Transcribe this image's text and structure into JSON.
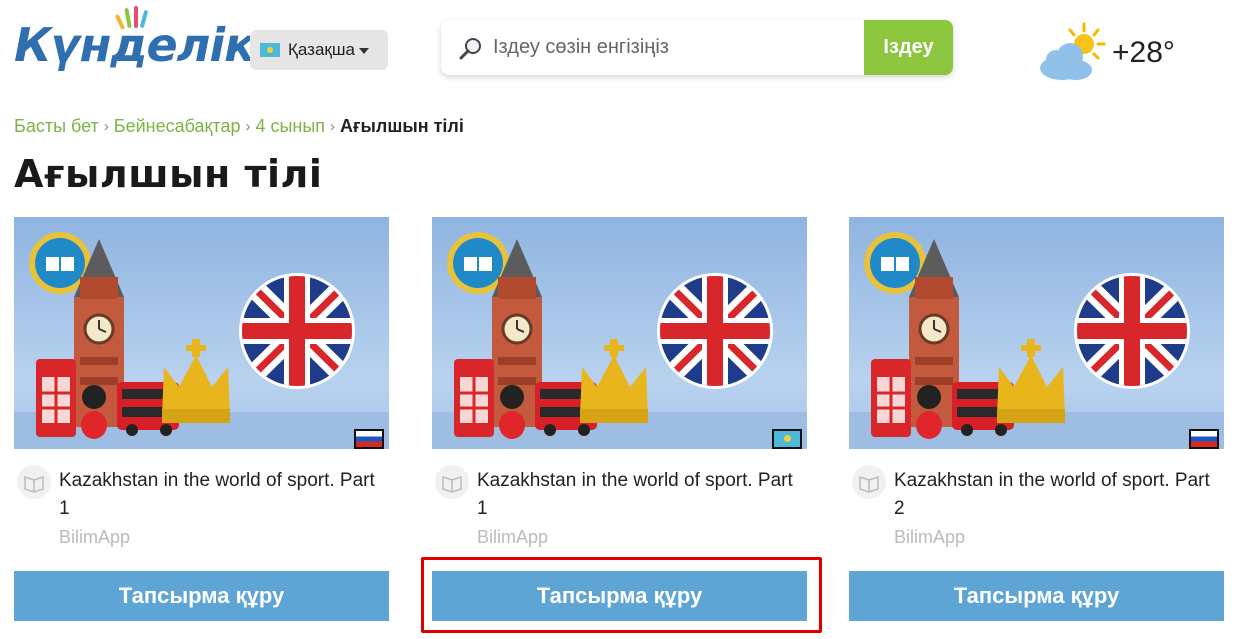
{
  "header": {
    "logo_text": "Күнделік",
    "language": {
      "label": "Қазақша",
      "flag_icon": "kazakhstan-flag-icon"
    },
    "search": {
      "placeholder": "Іздеу сөзін енгізіңіз",
      "value": "",
      "button_label": "Іздеу",
      "icon": "magnifier-icon"
    },
    "weather": {
      "icon": "sun-cloud-icon",
      "temperature": "+28°"
    }
  },
  "breadcrumb": [
    {
      "label": "Басты бет"
    },
    {
      "label": "Бейнесабақтар"
    },
    {
      "label": "4 сынып"
    },
    {
      "label": "Ағылшын тілі"
    }
  ],
  "page_title": "Ағылшын тілі",
  "cards": [
    {
      "title": "Kazakhstan in the world of sport. Part 1",
      "source": "BilimApp",
      "language_flag": "russia-flag-icon",
      "button_label": "Тапсырма құру"
    },
    {
      "title": "Kazakhstan in the world of sport. Part 1",
      "source": "BilimApp",
      "language_flag": "kazakhstan-flag-icon",
      "button_label": "Тапсырма құру"
    },
    {
      "title": "Kazakhstan in the world of sport. Part 2",
      "source": "BilimApp",
      "language_flag": "russia-flag-icon",
      "button_label": "Тапсырма құру"
    }
  ],
  "colors": {
    "accent_green": "#8cc63f",
    "link_green": "#7cb342",
    "button_blue": "#5ea4d4",
    "highlight_red": "#e10000",
    "logo_blue": "#2f6fb0"
  }
}
